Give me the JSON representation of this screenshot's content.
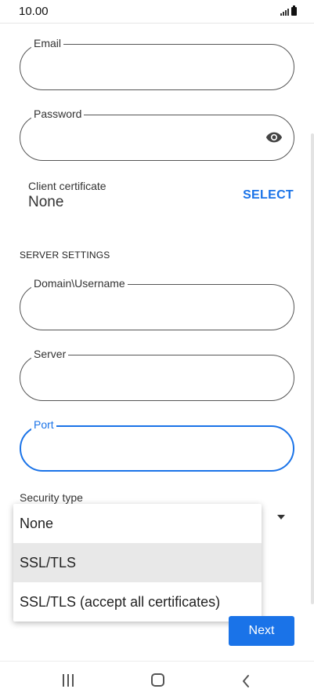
{
  "status_bar": {
    "time": "10.00"
  },
  "form": {
    "email": {
      "label": "Email",
      "value": ""
    },
    "password": {
      "label": "Password",
      "value": ""
    },
    "client_certificate": {
      "label": "Client certificate",
      "value": "None",
      "action": "SELECT"
    },
    "server_settings": {
      "heading": "SERVER SETTINGS",
      "domain_username": {
        "label": "Domain\\Username",
        "value": ""
      },
      "server": {
        "label": "Server",
        "value": ""
      },
      "port": {
        "label": "Port",
        "value": "",
        "focused": true
      }
    },
    "security_type": {
      "label": "Security type",
      "options": [
        "None",
        "SSL/TLS",
        "SSL/TLS (accept all certificates)"
      ],
      "highlighted": "SSL/TLS"
    },
    "next_label": "Next"
  },
  "colors": {
    "accent": "#1a73e8",
    "highlight": "#e8e8e8"
  },
  "icons": {
    "password_toggle": "eye-icon",
    "nav": [
      "recent-apps-icon",
      "home-icon",
      "back-icon"
    ]
  }
}
